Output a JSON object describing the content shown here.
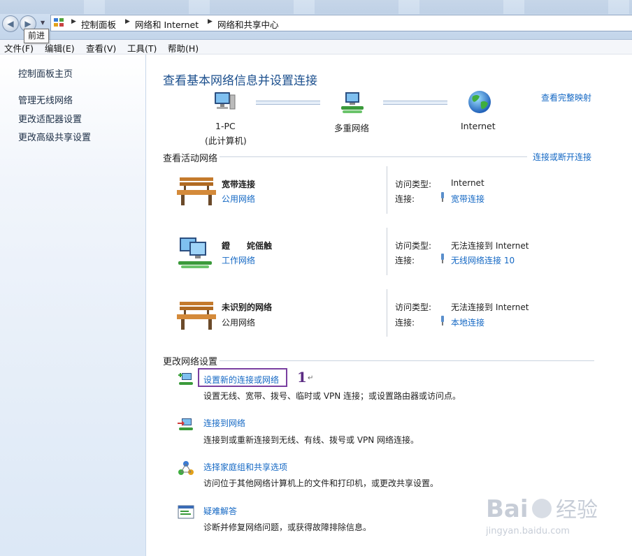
{
  "nav": {
    "back_glyph": "◀",
    "forward_glyph": "▶",
    "tooltip": "前进"
  },
  "breadcrumb": [
    "控制面板",
    "网络和 Internet",
    "网络和共享中心"
  ],
  "menu": [
    "文件(F)",
    "编辑(E)",
    "查看(V)",
    "工具(T)",
    "帮助(H)"
  ],
  "sidebar": {
    "home": "控制面板主页",
    "items": [
      "管理无线网络",
      "更改适配器设置",
      "更改高级共享设置"
    ]
  },
  "main": {
    "title": "查看基本网络信息并设置连接",
    "view_full_map": "查看完整映射",
    "map": {
      "pc_name": "1-PC",
      "pc_sub": "(此计算机)",
      "multi": "多重网络",
      "internet": "Internet"
    },
    "active_header": "查看活动网络",
    "connect_disconnect": "连接或断开连接",
    "access_type_label": "访问类型:",
    "connection_label": "连接:",
    "networks": [
      {
        "name": "宽带连接",
        "category": "公用网络",
        "category_is_link": true,
        "access": "Internet",
        "connection": "宽带连接",
        "icon": "bench-icon"
      },
      {
        "name": "鐙　　姹傜触",
        "category": "工作网络",
        "category_is_link": true,
        "access": "无法连接到 Internet",
        "connection": "无线网络连接 10",
        "icon": "work-network-icon"
      },
      {
        "name": "未识别的网络",
        "category": "公用网络",
        "category_is_link": false,
        "access": "无法连接到 Internet",
        "connection": "本地连接",
        "icon": "bench-icon"
      }
    ],
    "change_header": "更改网络设置",
    "tasks": [
      {
        "title": "设置新的连接或网络",
        "desc": "设置无线、宽带、拨号、临时或 VPN 连接；或设置路由器或访问点。",
        "icon": "new-connection-icon"
      },
      {
        "title": "连接到网络",
        "desc": "连接到或重新连接到无线、有线、拨号或 VPN 网络连接。",
        "icon": "connect-network-icon"
      },
      {
        "title": "选择家庭组和共享选项",
        "desc": "访问位于其他网络计算机上的文件和打印机，或更改共享设置。",
        "icon": "homegroup-icon"
      },
      {
        "title": "疑难解答",
        "desc": "诊断并修复网络问题，或获得故障排除信息。",
        "icon": "troubleshoot-icon"
      }
    ],
    "annotation_number": "1",
    "annotation_mark": "↵"
  },
  "watermark": {
    "brand": "Bai",
    "brand_cn": "经验",
    "domain": "jingyan.baidu.com"
  },
  "colors": {
    "link": "#1468c4",
    "title": "#1b4f8d",
    "highlight": "#7a3fa0"
  }
}
